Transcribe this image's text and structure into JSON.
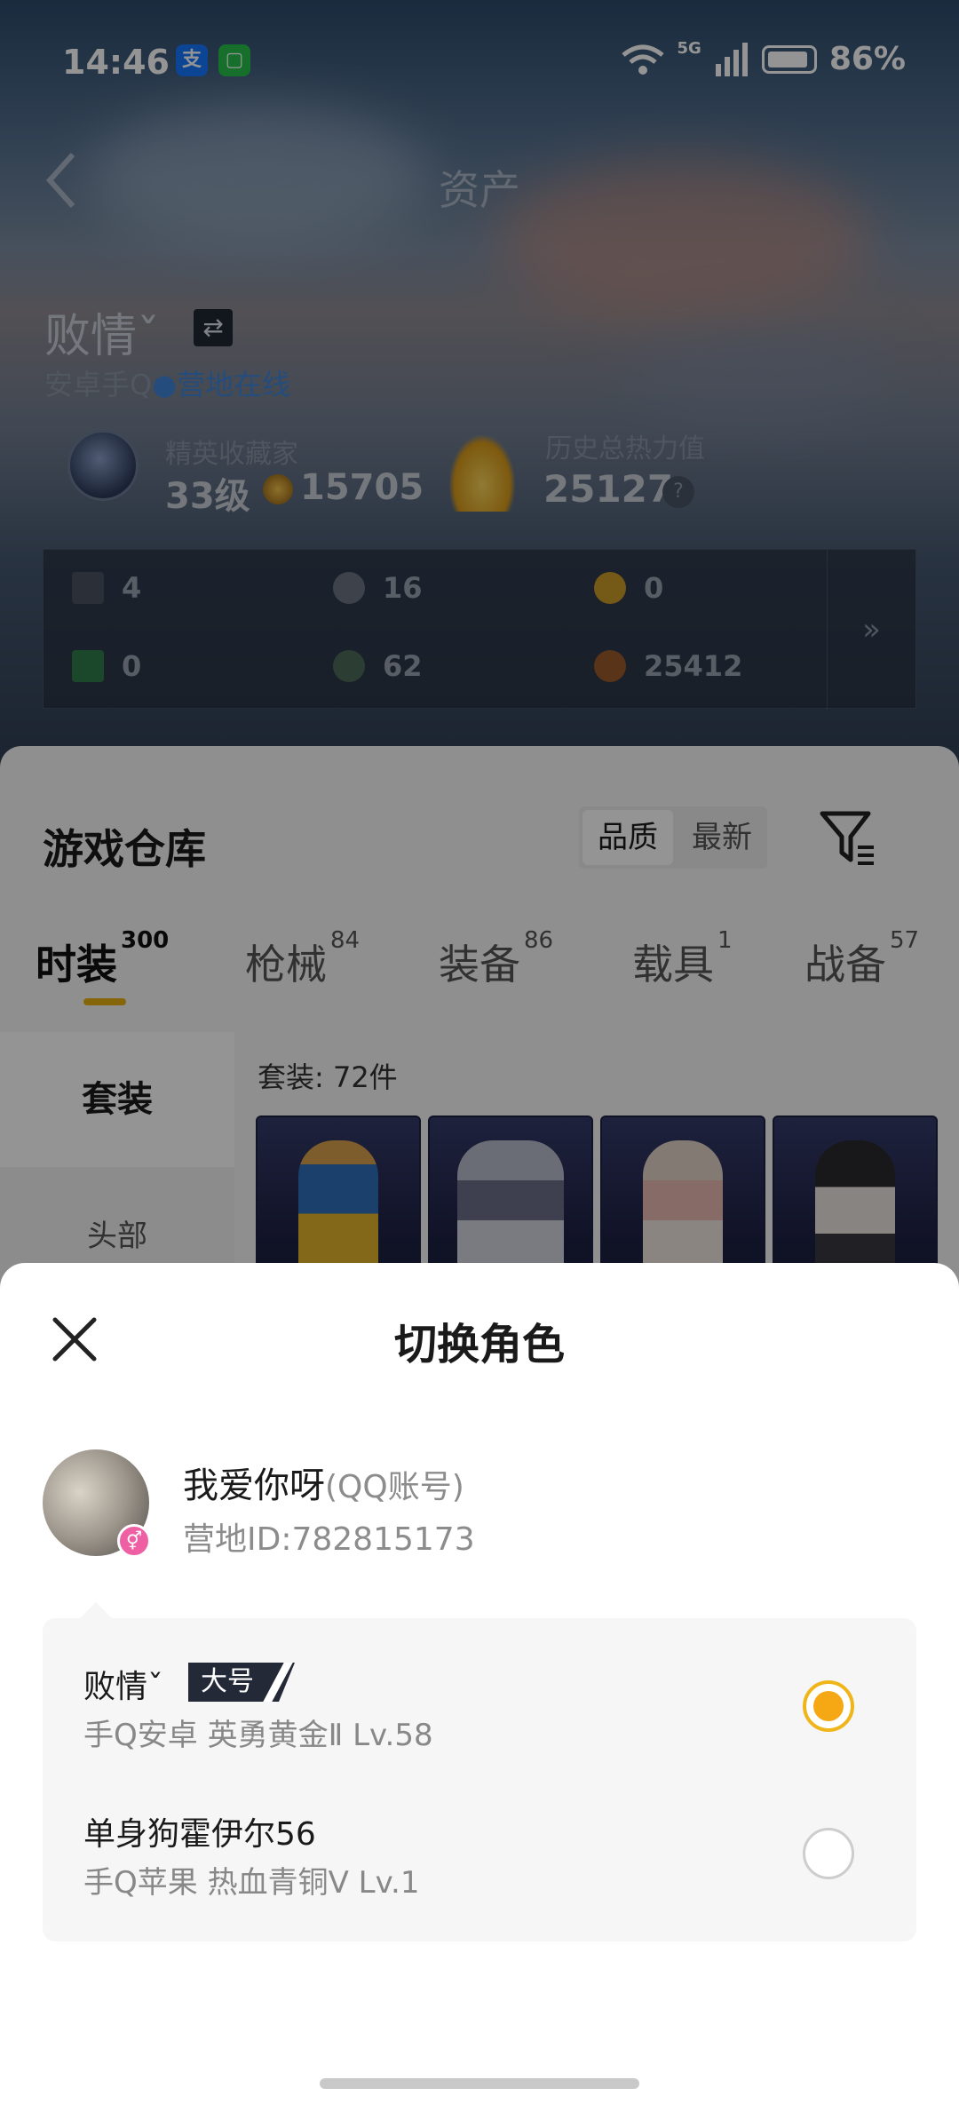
{
  "status_bar": {
    "time": "14:46",
    "app_icon_1": "支",
    "app_icon_2": "▢",
    "network": "5G",
    "battery": "86%"
  },
  "nav": {
    "title": "资产"
  },
  "player": {
    "name": "败情ˇ",
    "server": "安卓手Q",
    "online_status": "营地在线"
  },
  "rank": {
    "label": "精英收藏家",
    "level": "33级",
    "coins": "15705"
  },
  "heat": {
    "label": "历史总热力值",
    "value": "25127",
    "help": "?"
  },
  "stats": [
    {
      "value": "4",
      "icon": "card-icon",
      "color": "#4a5160"
    },
    {
      "value": "16",
      "icon": "badge-icon",
      "color": "#6b7280"
    },
    {
      "value": "0",
      "icon": "gold-medal-icon",
      "color": "#c89a28"
    },
    {
      "value": "0",
      "icon": "green-card-icon",
      "color": "#2f7d4a"
    },
    {
      "value": "62",
      "icon": "green-orb-icon",
      "color": "#4d6b58"
    },
    {
      "value": "25412",
      "icon": "bronze-coin-icon",
      "color": "#9b5a2a"
    }
  ],
  "stats_more": "»",
  "warehouse": {
    "title": "游戏仓库",
    "sort": [
      "品质",
      "最新"
    ],
    "tabs": [
      {
        "label": "时装",
        "count": "300"
      },
      {
        "label": "枪械",
        "count": "84"
      },
      {
        "label": "装备",
        "count": "86"
      },
      {
        "label": "载具",
        "count": "1"
      },
      {
        "label": "战备",
        "count": "57"
      }
    ],
    "side_nav": [
      "套装",
      "头部"
    ],
    "suit_count": "套装: 72件"
  },
  "sheet": {
    "title": "切换角色",
    "account_name": "我爱你呀",
    "account_type": "(QQ账号)",
    "account_id": "营地ID:782815173",
    "gender_symbol": "⚥",
    "roles": [
      {
        "name": "败情ˇ",
        "tag": "大号",
        "detail": "手Q安卓  英勇黄金Ⅱ  Lv.58",
        "selected": true
      },
      {
        "name": "单身狗霍伊尔56",
        "tag": "",
        "detail": "手Q苹果  热血青铜V  Lv.1",
        "selected": false
      }
    ]
  }
}
